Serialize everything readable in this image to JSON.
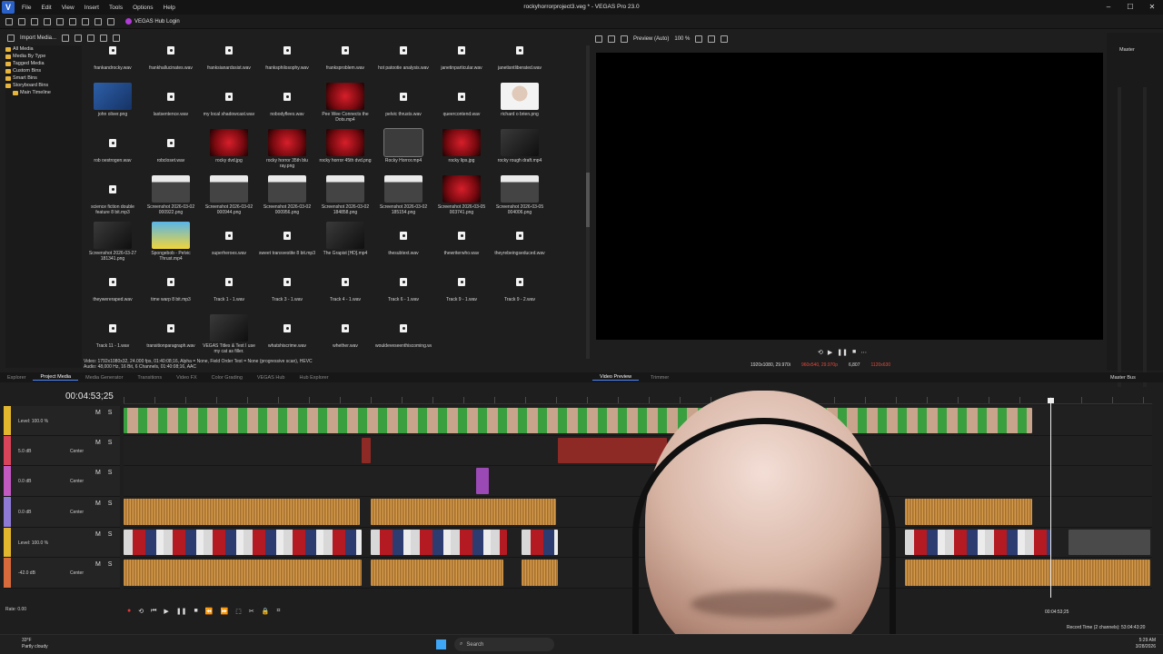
{
  "window": {
    "title": "rockyhorrorproject3.veg * - VEGAS Pro 23.0",
    "menu": [
      "File",
      "Edit",
      "View",
      "Insert",
      "Tools",
      "Options",
      "Help"
    ],
    "controls": [
      "–",
      "☐",
      "✕"
    ]
  },
  "toolbar": {
    "hub_login": "VEGAS Hub Login"
  },
  "explorer": {
    "import_label": "Import Media...",
    "tree": [
      "All Media",
      "Media By Type",
      "Tagged Media",
      "Custom Bins",
      "Smart Bins",
      "Storyboard Bins",
      "Main Timeline"
    ],
    "rows": [
      [
        {
          "label": "frankandrocky.wav",
          "kind": "audio"
        },
        {
          "label": "frankhallucinates.wav",
          "kind": "audio"
        },
        {
          "label": "franksianardssist.wav",
          "kind": "audio"
        },
        {
          "label": "franksphilosophy.wav",
          "kind": "audio"
        },
        {
          "label": "franksproblem.wav",
          "kind": "audio"
        },
        {
          "label": "hot patootie analysis.wav",
          "kind": "audio"
        },
        {
          "label": "janetinparticular.wav",
          "kind": "audio"
        },
        {
          "label": "janetisntliberated.wav",
          "kind": "audio"
        }
      ],
      [
        {
          "label": "john oliver.png",
          "kind": "img"
        },
        {
          "label": "lastsentence.wav",
          "kind": "audio"
        },
        {
          "label": "my local shadowcast.wav",
          "kind": "audio"
        },
        {
          "label": "nobodyflees.wav",
          "kind": "audio"
        },
        {
          "label": "Pee Wee Connects the Dots.mp4",
          "kind": "red"
        },
        {
          "label": "pelvic thrusts.wav",
          "kind": "audio"
        },
        {
          "label": "queercontend.wav",
          "kind": "audio"
        },
        {
          "label": "richard o brien.png",
          "kind": "face"
        }
      ],
      [
        {
          "label": "rob oestrogen.wav",
          "kind": "audio"
        },
        {
          "label": "robcloset.wav",
          "kind": "audio"
        },
        {
          "label": "rocky dvd.jpg",
          "kind": "red"
        },
        {
          "label": "rocky horror 35th blu ray.png",
          "kind": "red"
        },
        {
          "label": "rocky horror 45th dvd.png",
          "kind": "red"
        },
        {
          "label": "Rocky Horror.mp4",
          "kind": "sel"
        },
        {
          "label": "rocky lips.jpg",
          "kind": "red"
        },
        {
          "label": "rocky rough draft.mp4",
          "kind": "dark"
        }
      ],
      [
        {
          "label": "science fiction double feature 8 bit.mp3",
          "kind": "audio"
        },
        {
          "label": "Screenshot 2026-03-02 000922.png",
          "kind": "screen"
        },
        {
          "label": "Screenshot 2026-03-02 000944.png",
          "kind": "screen"
        },
        {
          "label": "Screenshot 2026-03-02 000956.png",
          "kind": "screen"
        },
        {
          "label": "Screenshot 2026-03-02 184858.png",
          "kind": "screen"
        },
        {
          "label": "Screenshot 2026-03-02 185154.png",
          "kind": "screen"
        },
        {
          "label": "Screenshot 2026-03-05 003741.png",
          "kind": "red"
        },
        {
          "label": "Screenshot 2026-03-05 004006.png",
          "kind": "screen"
        }
      ],
      [
        {
          "label": "Screenshot 2026-03-27 181341.png",
          "kind": "dark"
        },
        {
          "label": "Spongebob - Pelvic Thrust.mp4",
          "kind": "sponge"
        },
        {
          "label": "superheroes.wav",
          "kind": "audio"
        },
        {
          "label": "sweet transvestite 8 bit.mp3",
          "kind": "audio"
        },
        {
          "label": "The Grapist [HD].mp4",
          "kind": "dark"
        },
        {
          "label": "thesubtext.wav",
          "kind": "audio"
        },
        {
          "label": "thewriterwho.wav",
          "kind": "audio"
        },
        {
          "label": "theyrebeingseduced.wav",
          "kind": "audio"
        }
      ],
      [
        {
          "label": "theywereraped.wav",
          "kind": "audio"
        },
        {
          "label": "time warp 8 bit.mp3",
          "kind": "audio"
        },
        {
          "label": "Track 1 - 1.wav",
          "kind": "audio"
        },
        {
          "label": "Track 3 - 1.wav",
          "kind": "audio"
        },
        {
          "label": "Track 4 - 1.wav",
          "kind": "audio"
        },
        {
          "label": "Track 6 - 1.wav",
          "kind": "audio"
        },
        {
          "label": "Track 9 - 1.wav",
          "kind": "audio"
        },
        {
          "label": "Track 9 - 2.wav",
          "kind": "audio"
        }
      ],
      [
        {
          "label": "Track 11 - 1.wav",
          "kind": "audio"
        },
        {
          "label": "transitionparagraph.wav",
          "kind": "audio"
        },
        {
          "label": "VEGAS Titles & Text I use my cat as filler.",
          "kind": "dark"
        },
        {
          "label": "whatshiscrime.wav",
          "kind": "audio"
        },
        {
          "label": "whether.wav",
          "kind": "audio"
        },
        {
          "label": "wouldeveseenthiscoming.wav",
          "kind": "audio"
        }
      ]
    ],
    "media_info_1": "Video: 1792x1080x32, 24.000 fps, 01:40:08;16, Alpha = None, Field Order Test = None (progressive scan), HEVC",
    "media_info_2": "Audio: 48,000 Hz, 16 Bit, 6 Channels, 01:40:08;16, AAC"
  },
  "preview": {
    "mode": "Preview (Auto)",
    "zoom": "100 %",
    "status_project": "1920x1080, 29.970i",
    "status_preview": "960x540, 29.970p",
    "status_display": "6,807",
    "status_fps": "1120x630"
  },
  "master": {
    "title": "Master",
    "mix_title": "Master Bus"
  },
  "tabs": [
    "Explorer",
    "Project Media",
    "Media Generator",
    "Transitions",
    "Video FX",
    "Color Grading",
    "VEGAS Hub",
    "Hub Explorer"
  ],
  "right_tabs": [
    "Video Preview",
    "Trimmer"
  ],
  "timeline": {
    "timecode": "00:04:53;25",
    "rate": "Rate: 0.00",
    "cursor_time": "00:04:53;25",
    "record_time": "Record Time (2 channels): 53:04:43:20",
    "tracks": [
      {
        "level": "Level: 100.0 %",
        "pan": "",
        "color": "#e3b72d"
      },
      {
        "level": "5.0 dB",
        "pan": "Center",
        "color": "#d8455a"
      },
      {
        "level": "0.0 dB",
        "pan": "Center",
        "color": "#c35ac2"
      },
      {
        "level": "0.0 dB",
        "pan": "Center",
        "color": "#8f7bd6"
      },
      {
        "level": "Level: 100.0 %",
        "pan": "",
        "color": "#e3b72d"
      },
      {
        "level": "-42.0 dB",
        "pan": "Center",
        "color": "#d86a3b"
      }
    ]
  },
  "taskbar": {
    "weather_temp": "33°F",
    "weather_desc": "Partly cloudy",
    "search_placeholder": "Search",
    "time": "5:29 AM",
    "date": "3/28/2026"
  }
}
